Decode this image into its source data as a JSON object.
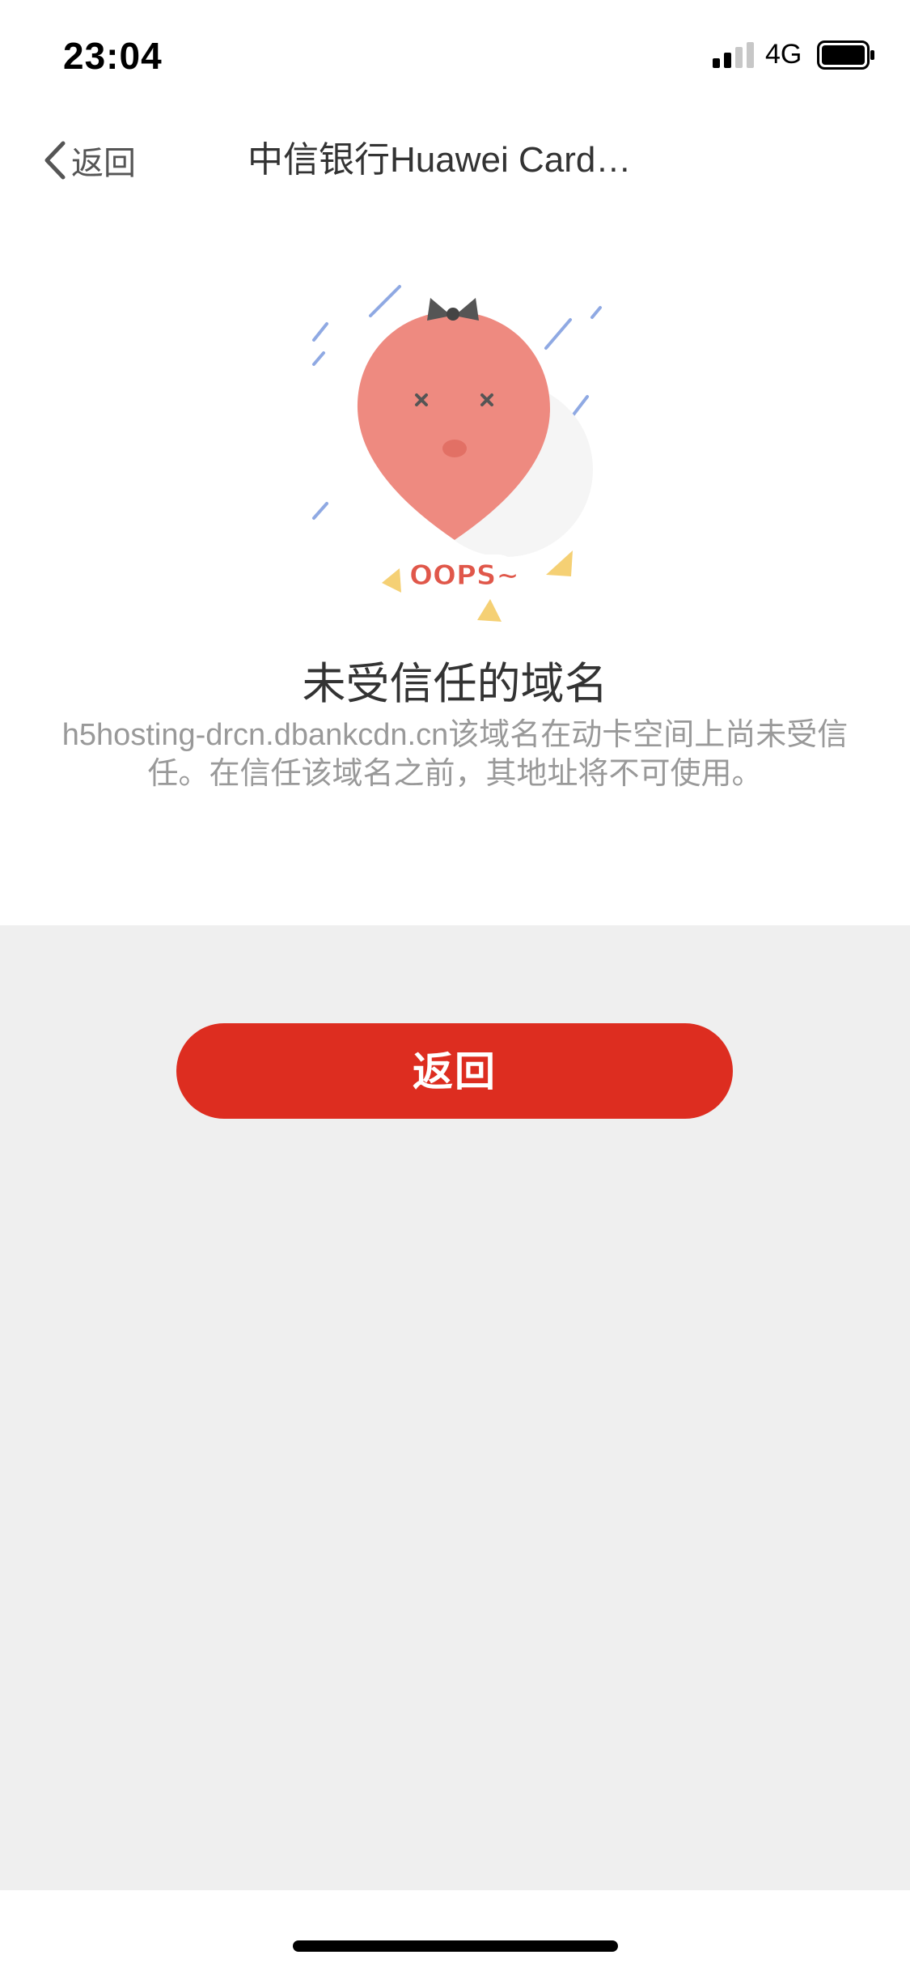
{
  "status_bar": {
    "time": "23:04",
    "network": "4G",
    "signal_icon": "signal-icon",
    "battery_icon": "battery-icon"
  },
  "nav": {
    "back_label": "返回",
    "title": "中信银行Huawei Card…"
  },
  "illustration": {
    "badge_text": "OOPS~",
    "icon": "broken-balloon-illustration"
  },
  "error": {
    "title": "未受信任的域名",
    "description": "h5hosting-drcn.dbankcdn.cn该域名在动卡空间上尚未受信任。在信任该域名之前，其地址将不可使用。"
  },
  "actions": {
    "return_label": "返回"
  },
  "colors": {
    "accent": "#dd2d20",
    "gray_background": "#efefef",
    "balloon": "#ee8a80"
  }
}
